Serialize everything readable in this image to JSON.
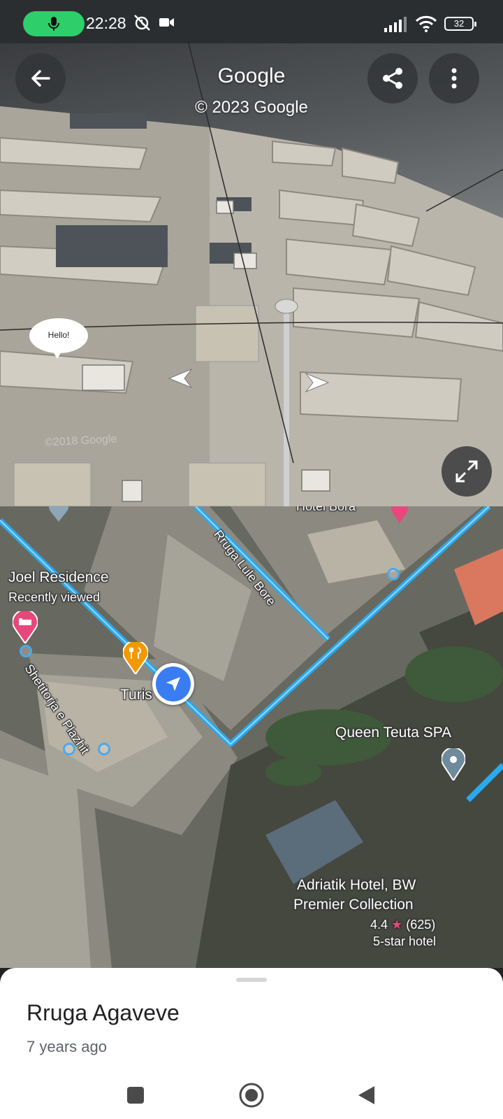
{
  "status_bar": {
    "time": "22:28",
    "battery": "32",
    "icons": [
      "mic-icon",
      "alarm-off-icon",
      "video-camera-icon",
      "signal-icon",
      "wifi-icon",
      "battery-icon"
    ]
  },
  "street_view": {
    "title": "Google",
    "copyright": "© 2023 Google",
    "watermark": "©2018 Google",
    "bubble_text": "Hello!",
    "buttons": [
      "back-arrow-icon",
      "share-icon",
      "more-vert-icon",
      "expand-icon"
    ]
  },
  "map": {
    "labels": {
      "hotel_bora": "Hotel Bora",
      "road_lule_bore": "Rruga Lule Bore",
      "joel_residence": "Joel Residence",
      "recently_viewed": "Recently viewed",
      "road_shetitorja": "Shetitorja e Plazhit",
      "turis": "Turis",
      "queen_teuta": "Queen Teuta SPA",
      "adriatik_hotel_line1": "Adriatik Hotel, BW",
      "adriatik_hotel_line2": "Premier Collection",
      "adriatik_rating": "4.4",
      "adriatik_reviews": "(625)",
      "adriatik_category": "5-star hotel"
    },
    "colors": {
      "route_blue": "#29a9ee",
      "hotel_pin": "#e8477b",
      "restaurant_pin": "#f29900",
      "location_dot": "#3a7df2"
    }
  },
  "sheet": {
    "place_name": "Rruga Agaveve",
    "date": "7 years ago"
  },
  "nav_bar": {
    "buttons": [
      "recents-square-icon",
      "home-circle-icon",
      "back-triangle-icon"
    ]
  }
}
